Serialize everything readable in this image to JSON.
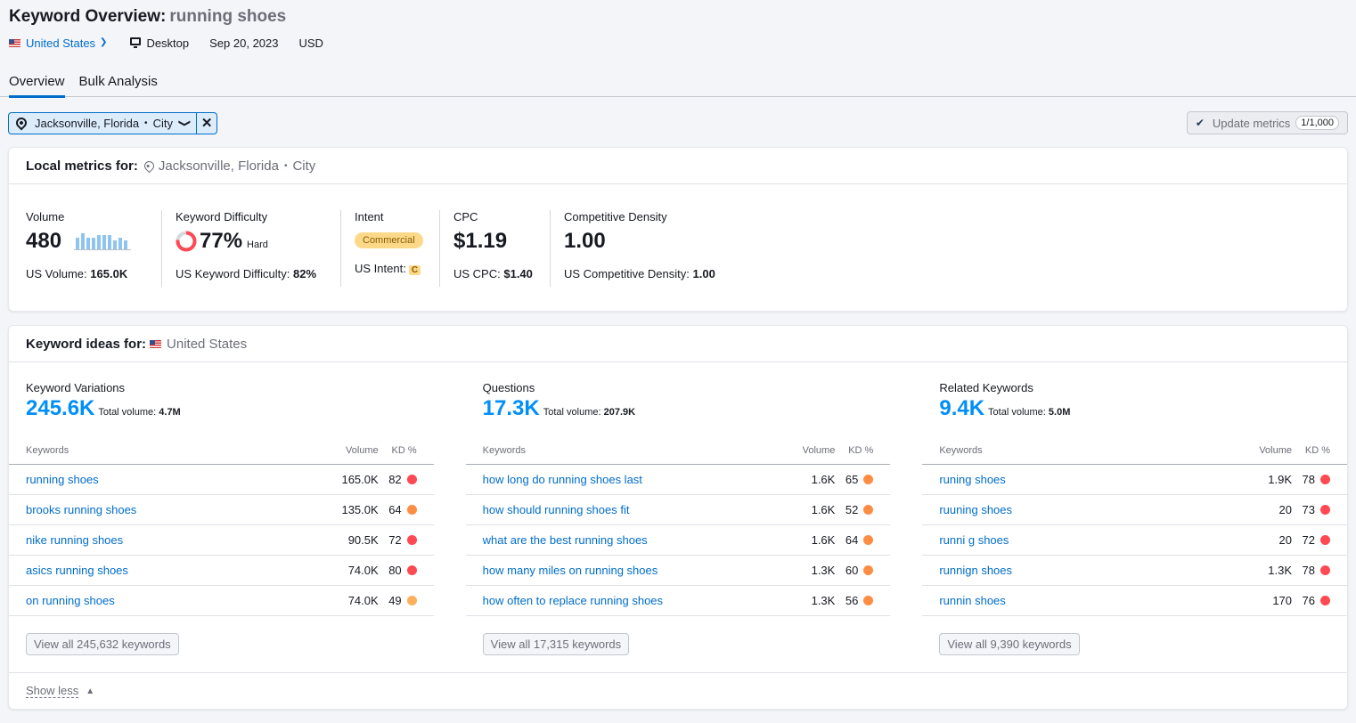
{
  "header": {
    "title": "Keyword Overview:",
    "keyword": "running shoes",
    "database": "United States",
    "device": "Desktop",
    "date": "Sep 20, 2023",
    "currency": "USD"
  },
  "tabs": [
    {
      "label": "Overview",
      "active": true
    },
    {
      "label": "Bulk Analysis",
      "active": false
    }
  ],
  "location_filter": {
    "location": "Jacksonville, Florida",
    "type": "City"
  },
  "update_metrics": {
    "label": "Update metrics",
    "count": "1/1,000"
  },
  "local_metrics": {
    "heading": "Local metrics for:",
    "location": "Jacksonville, Florida",
    "type": "City",
    "volume": {
      "label": "Volume",
      "value": "480",
      "trend": [
        0.65,
        0.9,
        0.65,
        0.65,
        0.8,
        0.8,
        0.8,
        0.5,
        0.65,
        0.5
      ],
      "sub_label": "US Volume:",
      "sub_value": "165.0K"
    },
    "kd": {
      "label": "Keyword Difficulty",
      "value": "77%",
      "percent": 77,
      "level": "Hard",
      "sub_label": "US Keyword Difficulty:",
      "sub_value": "82%",
      "color": "#ff4953"
    },
    "intent": {
      "label": "Intent",
      "value": "Commercial",
      "sub_label": "US Intent:",
      "sub_value": "C"
    },
    "cpc": {
      "label": "CPC",
      "value": "$1.19",
      "sub_label": "US CPC:",
      "sub_value": "$1.40"
    },
    "density": {
      "label": "Competitive Density",
      "value": "1.00",
      "sub_label": "US Competitive Density:",
      "sub_value": "1.00"
    }
  },
  "keyword_ideas": {
    "heading": "Keyword ideas for:",
    "database": "United States",
    "columns_header": {
      "keywords": "Keywords",
      "volume": "Volume",
      "kd": "KD %"
    },
    "total_volume_label": "Total volume:",
    "groups": [
      {
        "title": "Keyword Variations",
        "count": "245.6K",
        "total_volume": "4.7M",
        "view_all": "View all 245,632 keywords",
        "rows": [
          {
            "keyword": "running shoes",
            "volume": "165.0K",
            "kd": "82",
            "kd_color": "#ff4953"
          },
          {
            "keyword": "brooks running shoes",
            "volume": "135.0K",
            "kd": "64",
            "kd_color": "#ff8c43"
          },
          {
            "keyword": "nike running shoes",
            "volume": "90.5K",
            "kd": "72",
            "kd_color": "#ff4953"
          },
          {
            "keyword": "asics running shoes",
            "volume": "74.0K",
            "kd": "80",
            "kd_color": "#ff4953"
          },
          {
            "keyword": "on running shoes",
            "volume": "74.0K",
            "kd": "49",
            "kd_color": "#fdb05a"
          }
        ]
      },
      {
        "title": "Questions",
        "count": "17.3K",
        "total_volume": "207.9K",
        "view_all": "View all 17,315 keywords",
        "rows": [
          {
            "keyword": "how long do running shoes last",
            "volume": "1.6K",
            "kd": "65",
            "kd_color": "#ff8c43"
          },
          {
            "keyword": "how should running shoes fit",
            "volume": "1.6K",
            "kd": "52",
            "kd_color": "#ff8c43"
          },
          {
            "keyword": "what are the best running shoes",
            "volume": "1.6K",
            "kd": "64",
            "kd_color": "#ff8c43"
          },
          {
            "keyword": "how many miles on running shoes",
            "volume": "1.3K",
            "kd": "60",
            "kd_color": "#ff8c43"
          },
          {
            "keyword": "how often to replace running shoes",
            "volume": "1.3K",
            "kd": "56",
            "kd_color": "#ff8c43"
          }
        ]
      },
      {
        "title": "Related Keywords",
        "count": "9.4K",
        "total_volume": "5.0M",
        "view_all": "View all 9,390 keywords",
        "rows": [
          {
            "keyword": "runing shoes",
            "volume": "1.9K",
            "kd": "78",
            "kd_color": "#ff4953"
          },
          {
            "keyword": "ruuning shoes",
            "volume": "20",
            "kd": "73",
            "kd_color": "#ff4953"
          },
          {
            "keyword": "runni g shoes",
            "volume": "20",
            "kd": "72",
            "kd_color": "#ff4953"
          },
          {
            "keyword": "runnign shoes",
            "volume": "1.3K",
            "kd": "78",
            "kd_color": "#ff4953"
          },
          {
            "keyword": "runnin shoes",
            "volume": "170",
            "kd": "76",
            "kd_color": "#ff4953"
          }
        ]
      }
    ],
    "show_less": "Show less"
  }
}
